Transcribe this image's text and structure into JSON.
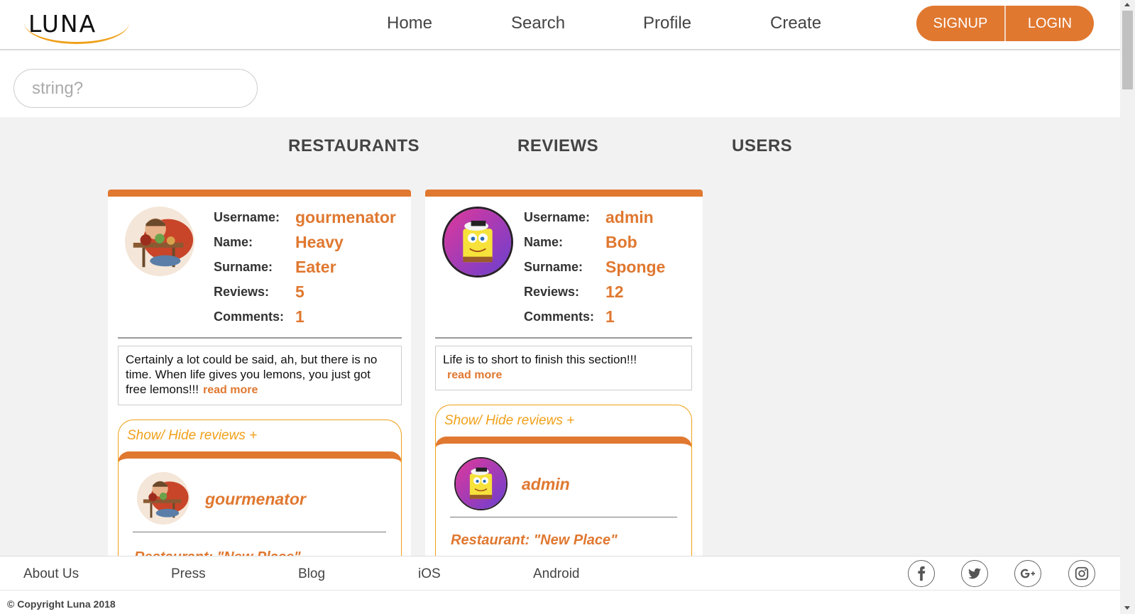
{
  "header": {
    "logo_text": "LUNA",
    "nav": [
      "Home",
      "Search",
      "Profile",
      "Create"
    ],
    "signup_label": "SIGNUP",
    "login_label": "LOGIN"
  },
  "search": {
    "placeholder": "string?"
  },
  "tabs": [
    "RESTAURANTS",
    "REVIEWS",
    "USERS"
  ],
  "colors": {
    "accent": "#e07830",
    "accent_light": "#f0a019",
    "background": "#f2f2f2"
  },
  "users": [
    {
      "avatar_icon": "cartoon-eater-avatar",
      "labels": [
        "Username:",
        "Name:",
        "Surname:",
        "Reviews:",
        "Comments:"
      ],
      "values": [
        "gourmenator",
        "Heavy",
        "Eater",
        "5",
        "1"
      ],
      "bio": "Certainly a lot could be said, ah, but there is no time. When life gives you lemons, you just got free lemons!!!",
      "read_more": "read more",
      "toggle": "Show/ Hide reviews +",
      "review_user": "gourmenator",
      "review_restaurant": "Restaurant: \"New Place\""
    },
    {
      "avatar_icon": "spongebob-avatar",
      "labels": [
        "Username:",
        "Name:",
        "Surname:",
        "Reviews:",
        "Comments:"
      ],
      "values": [
        "admin",
        "Bob",
        "Sponge",
        "12",
        "1"
      ],
      "bio": "Life is to short to finish this section!!!",
      "read_more": "read more",
      "toggle": "Show/ Hide reviews +",
      "review_user": "admin",
      "review_restaurant": "Restaurant: \"New Place\""
    }
  ],
  "footer": {
    "links": [
      "About Us",
      "Press",
      "Blog",
      "iOS",
      "Android"
    ],
    "social_icons": [
      "facebook-icon",
      "twitter-icon",
      "google-plus-icon",
      "instagram-icon"
    ],
    "copyright": "© Copyright Luna 2018"
  }
}
